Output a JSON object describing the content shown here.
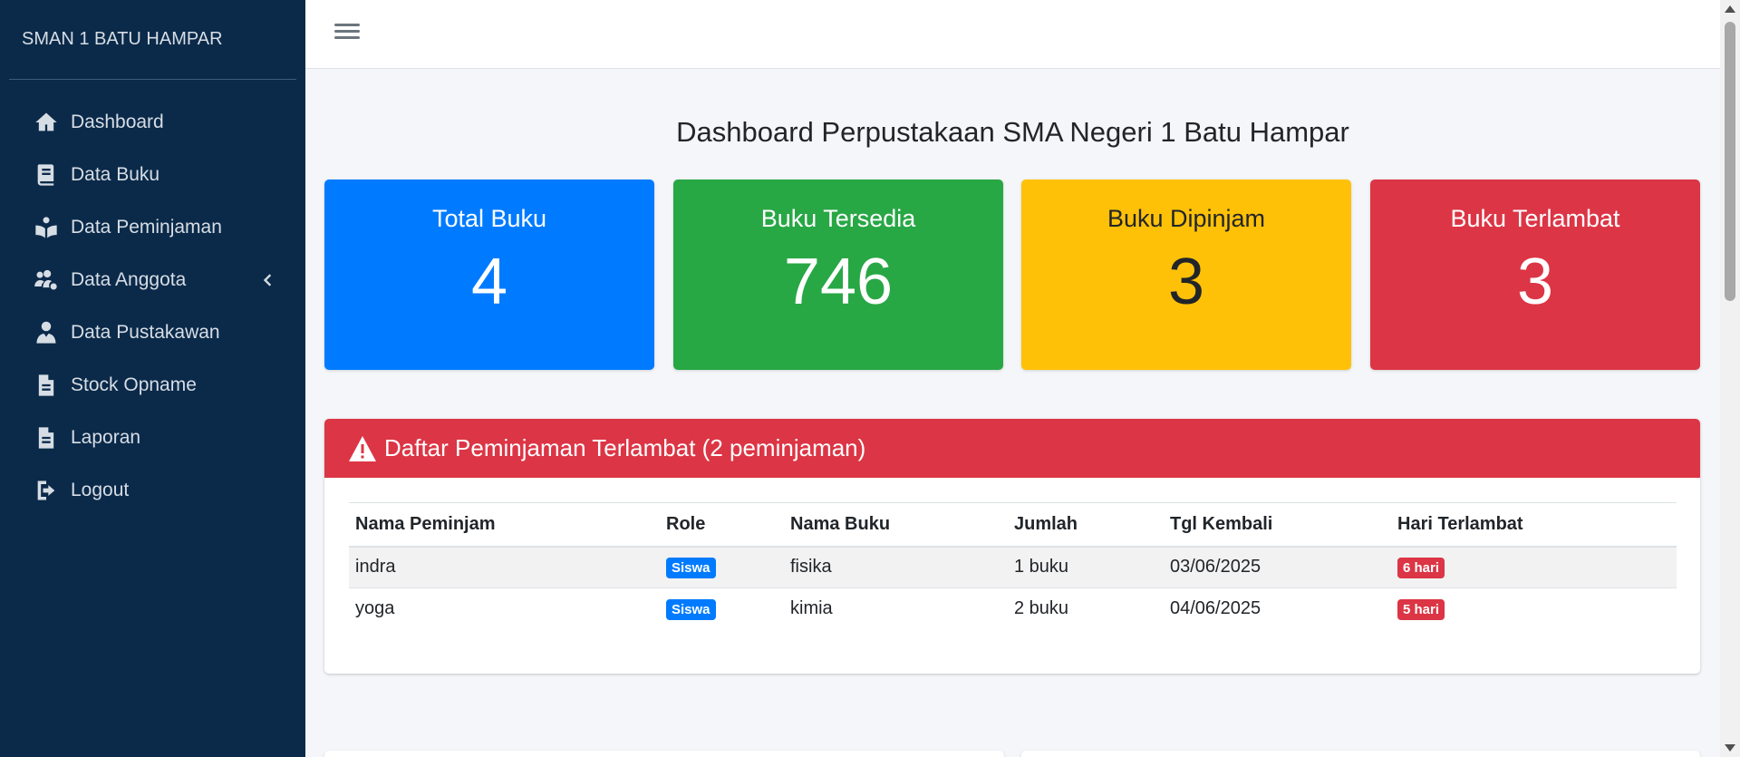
{
  "sidebar": {
    "brand": "SMAN 1 BATU HAMPAR",
    "items": [
      {
        "label": "Dashboard",
        "icon": "home-icon"
      },
      {
        "label": "Data Buku",
        "icon": "book-icon"
      },
      {
        "label": "Data Peminjaman",
        "icon": "reader-icon"
      },
      {
        "label": "Data Anggota",
        "icon": "users-cog-icon"
      },
      {
        "label": "Data Pustakawan",
        "icon": "user-tie-icon"
      },
      {
        "label": "Stock Opname",
        "icon": "file-icon"
      },
      {
        "label": "Laporan",
        "icon": "file-icon"
      },
      {
        "label": "Logout",
        "icon": "sign-out-icon"
      }
    ]
  },
  "main": {
    "title": "Dashboard Perpustakaan SMA Negeri 1 Batu Hampar",
    "cards": [
      {
        "title": "Total Buku",
        "value": "4",
        "color": "#007bff"
      },
      {
        "title": "Buku Tersedia",
        "value": "746",
        "color": "#28a745"
      },
      {
        "title": "Buku Dipinjam",
        "value": "3",
        "color": "#ffc107"
      },
      {
        "title": "Buku Terlambat",
        "value": "3",
        "color": "#dc3545"
      }
    ],
    "late": {
      "header": "Daftar Peminjaman Terlambat (2 peminjaman)",
      "columns": [
        "Nama Peminjam",
        "Role",
        "Nama Buku",
        "Jumlah",
        "Tgl Kembali",
        "Hari Terlambat"
      ],
      "rows": [
        {
          "name": "indra",
          "role": "Siswa",
          "book": "fisika",
          "qty": "1 buku",
          "date": "03/06/2025",
          "late": "6 hari"
        },
        {
          "name": "yoga",
          "role": "Siswa",
          "book": "kimia",
          "qty": "2 buku",
          "date": "04/06/2025",
          "late": "5 hari"
        }
      ]
    }
  }
}
